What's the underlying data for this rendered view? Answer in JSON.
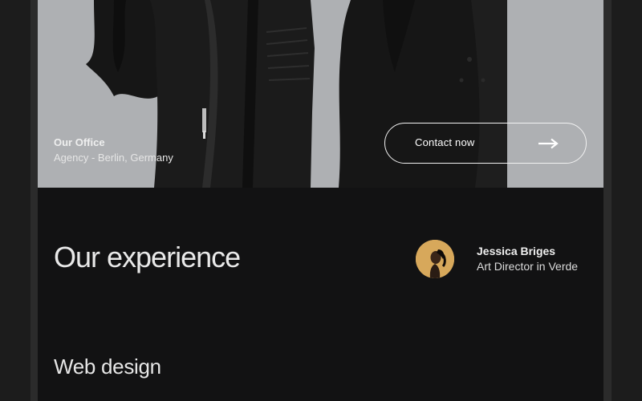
{
  "hero": {
    "office_title": "Our Office",
    "office_location": "Agency - Berlin, Germany",
    "contact_label": "Contact now",
    "arrow_icon": "arrow-right-icon"
  },
  "experience": {
    "title": "Our experience",
    "author_name": "Jessica Briges",
    "author_role": "Art Director in Verde"
  },
  "services": {
    "first": "Web design"
  },
  "colors": {
    "background": "#121213",
    "avatar_bg": "#d7a85b",
    "text": "#e9e9e9"
  }
}
